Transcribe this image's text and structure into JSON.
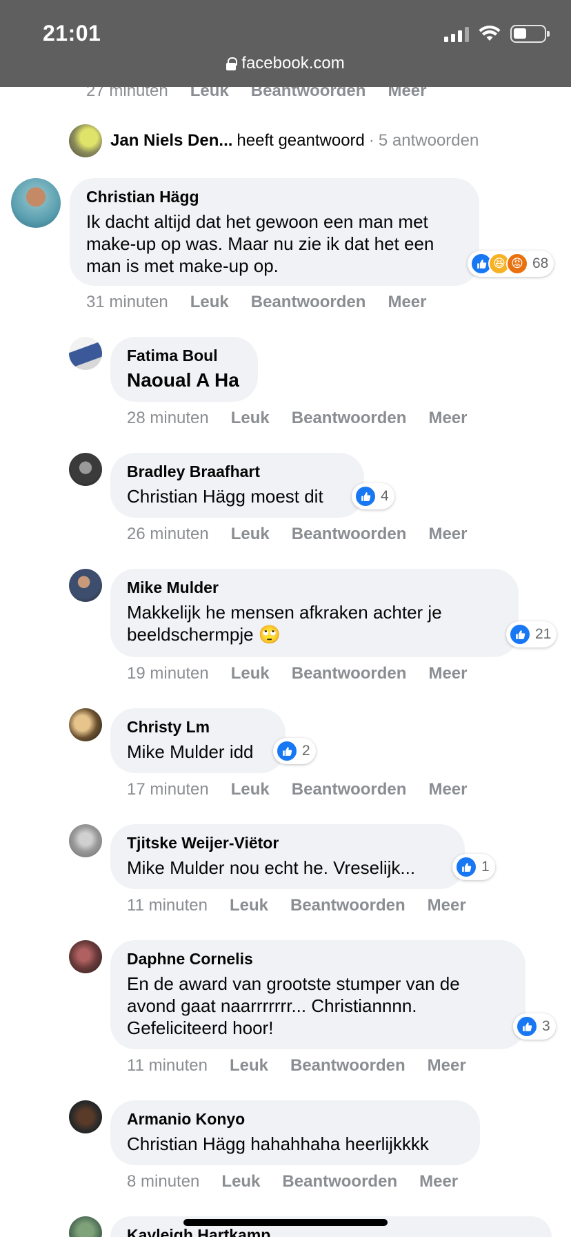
{
  "status_bar": {
    "time": "21:01"
  },
  "browser": {
    "url": "facebook.com"
  },
  "top_partial_meta": {
    "time_ago": "27 minuten",
    "like": "Leuk",
    "reply": "Beantwoorden",
    "more": "Meer"
  },
  "reply_summary": {
    "name": "Jan Niels Den...",
    "action": "heeft geantwoord",
    "separator": "·",
    "count": "5 antwoorden"
  },
  "colors": {
    "like_blue": "#1877f2",
    "bubble_bg": "#f0f2f5",
    "meta_grey": "#8a8d91",
    "topbar": "#5f5f5f"
  },
  "comments": [
    {
      "name": "Christian Hägg",
      "text": "Ik dacht altijd dat het gewoon een man met make-up op was. Maar nu zie ik dat het een man is met make-up op.",
      "time_ago": "31 minuten",
      "like": "Leuk",
      "reply": "Beantwoorden",
      "more": "Meer",
      "reactions": [
        "like-icon",
        "haha-icon",
        "angry-icon"
      ],
      "reaction_count": "68"
    },
    {
      "name": "Fatima Boul",
      "text": "Naoual A Ha",
      "time_ago": "28 minuten",
      "like": "Leuk",
      "reply": "Beantwoorden",
      "more": "Meer"
    },
    {
      "name": "Bradley Braafhart",
      "text": "Christian Hägg moest dit",
      "time_ago": "26 minuten",
      "like": "Leuk",
      "reply": "Beantwoorden",
      "more": "Meer",
      "reactions": [
        "like-icon"
      ],
      "reaction_count": "4"
    },
    {
      "name": "Mike Mulder",
      "text": "Makkelijk he mensen afkraken achter je beeldschermpje 🙄",
      "time_ago": "19 minuten",
      "like": "Leuk",
      "reply": "Beantwoorden",
      "more": "Meer",
      "reactions": [
        "like-icon"
      ],
      "reaction_count": "21"
    },
    {
      "name": "Christy Lm",
      "text": "Mike Mulder idd",
      "time_ago": "17 minuten",
      "like": "Leuk",
      "reply": "Beantwoorden",
      "more": "Meer",
      "reactions": [
        "like-icon"
      ],
      "reaction_count": "2"
    },
    {
      "name": "Tjitske Weijer-Viëtor",
      "text": "Mike Mulder nou echt he. Vreselijk...",
      "time_ago": "11 minuten",
      "like": "Leuk",
      "reply": "Beantwoorden",
      "more": "Meer",
      "reactions": [
        "like-icon"
      ],
      "reaction_count": "1"
    },
    {
      "name": "Daphne Cornelis",
      "text": "En de award van grootste stumper van de avond gaat naarrrrrrr... Christiannnn. Gefeliciteerd hoor!",
      "time_ago": "11 minuten",
      "like": "Leuk",
      "reply": "Beantwoorden",
      "more": "Meer",
      "reactions": [
        "like-icon"
      ],
      "reaction_count": "3"
    },
    {
      "name": "Armanio Konyo",
      "text": "Christian Hägg hahahhaha heerlijkkkk",
      "time_ago": "8 minuten",
      "like": "Leuk",
      "reply": "Beantwoorden",
      "more": "Meer"
    },
    {
      "name": "Kayleigh Hartkamp"
    }
  ]
}
